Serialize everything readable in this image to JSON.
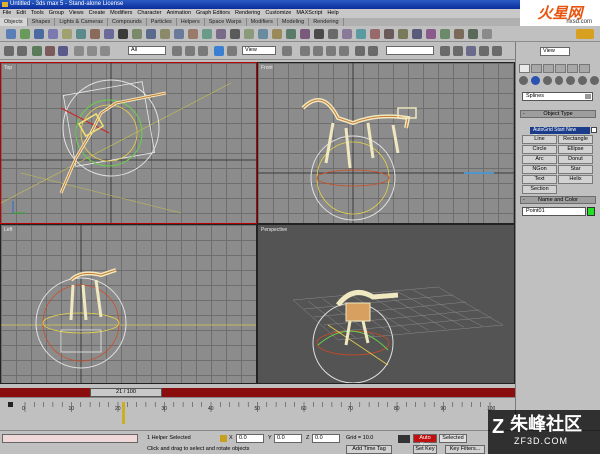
{
  "window": {
    "title": "Untitled - 3ds max 5 - Stand-alone License"
  },
  "menu": [
    "File",
    "Edit",
    "Tools",
    "Group",
    "Views",
    "Create",
    "Modifiers",
    "Character",
    "Animation",
    "Graph Editors",
    "Rendering",
    "Customize",
    "MAXScript",
    "Help"
  ],
  "tabs": [
    "Objects",
    "Shapes",
    "Lights & Cameras",
    "Compounds",
    "Particles",
    "Helpers",
    "Space Warps",
    "Modifiers",
    "Modeling",
    "Rendering"
  ],
  "watermark_top": {
    "brand": "火星网",
    "url": "hxsd.com"
  },
  "toolbar": {
    "selection_filter": "All",
    "ref_coord": "View",
    "named_sets": "",
    "view_right": "View"
  },
  "viewports": {
    "top": "Top",
    "front": "Front",
    "left": "Left",
    "perspective": "Perspective"
  },
  "command_panel": {
    "category": "Splines",
    "object_type_title": "Object Type",
    "autogrid": "AutoGrid Start New Shape",
    "shapes": [
      "Line",
      "Rectangle",
      "Circle",
      "Ellipse",
      "Arc",
      "Donut",
      "NGon",
      "Star",
      "Text",
      "Helix",
      "Section"
    ],
    "name_color_title": "Name and Color",
    "object_name": "Point01",
    "object_color": "#22e022"
  },
  "timeline": {
    "frame_display": "21 / 100",
    "current_frame": 21,
    "total_frames": 100,
    "ticks": [
      "0",
      "10",
      "20",
      "30",
      "40",
      "50",
      "60",
      "70",
      "80",
      "90",
      "100"
    ]
  },
  "status": {
    "selection": "1 Helper Selected",
    "prompt": "Click and drag to select and rotate objects",
    "x_label": "X",
    "x_value": "0.0",
    "y_label": "Y",
    "y_value": "0.0",
    "z_label": "Z",
    "z_value": "0.0",
    "grid": "Grid = 10.0",
    "add_time_tag": "Add Time Tag",
    "auto_key": "Auto Key",
    "selected": "Selected",
    "set_key": "Set Key",
    "key_filters": "Key Filters..."
  },
  "watermark": {
    "text": "朱峰社区",
    "url": "ZF3D.COM"
  }
}
